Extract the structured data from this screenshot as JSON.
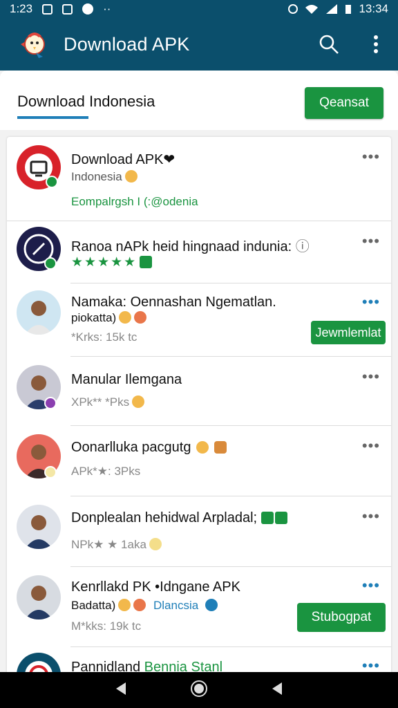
{
  "status_bar": {
    "time": "1:23",
    "clock": "13:34"
  },
  "app_bar": {
    "title": "Download APK",
    "icons": {
      "logo": "chicken-mascot-logo",
      "search": "search-icon",
      "menu": "overflow-menu-icon"
    }
  },
  "tab": {
    "label": "Download Indonesia",
    "button_label": "Qeansat"
  },
  "items": [
    {
      "title": "Download APK❤",
      "sub1": "Indonesia",
      "sub2": "Eompalrgsh I (:@odenia"
    },
    {
      "title": "Ranoa nAPk heid hingnaad indunia:",
      "rating": "★★★★★",
      "info_icon": "ⓘ"
    },
    {
      "title": "Namaka: Oennashan Ngematlan.",
      "sub1": "piokatta)",
      "meta": "*Krks: 15k tc",
      "button_label": "Jewmlemlat"
    },
    {
      "title": "Manular Ilemgana",
      "meta": "XPk** *Pks"
    },
    {
      "title": "Oonarlluka pacgutg",
      "meta": "APk*★: 3Pks"
    },
    {
      "title": "Donplealan hehidwal Arpladal;",
      "meta": "NPk★ ★ 1aka"
    },
    {
      "title": "Kenrllakd PK •Idngane APK",
      "sub1": "Badatta)",
      "sub_tag": "Dlancsia",
      "meta": "M*kks: 19k tc",
      "button_label": "Stubogpat"
    },
    {
      "title": "Pannidland",
      "title_tag": "Bennia Stanl"
    }
  ],
  "more_label": "•••",
  "nav": {
    "back": "back-icon",
    "home": "home-icon",
    "recents": "recents-icon"
  },
  "colors": {
    "primary": "#0b4f6c",
    "accent_green": "#1a9440",
    "accent_blue": "#1f7fb8"
  }
}
